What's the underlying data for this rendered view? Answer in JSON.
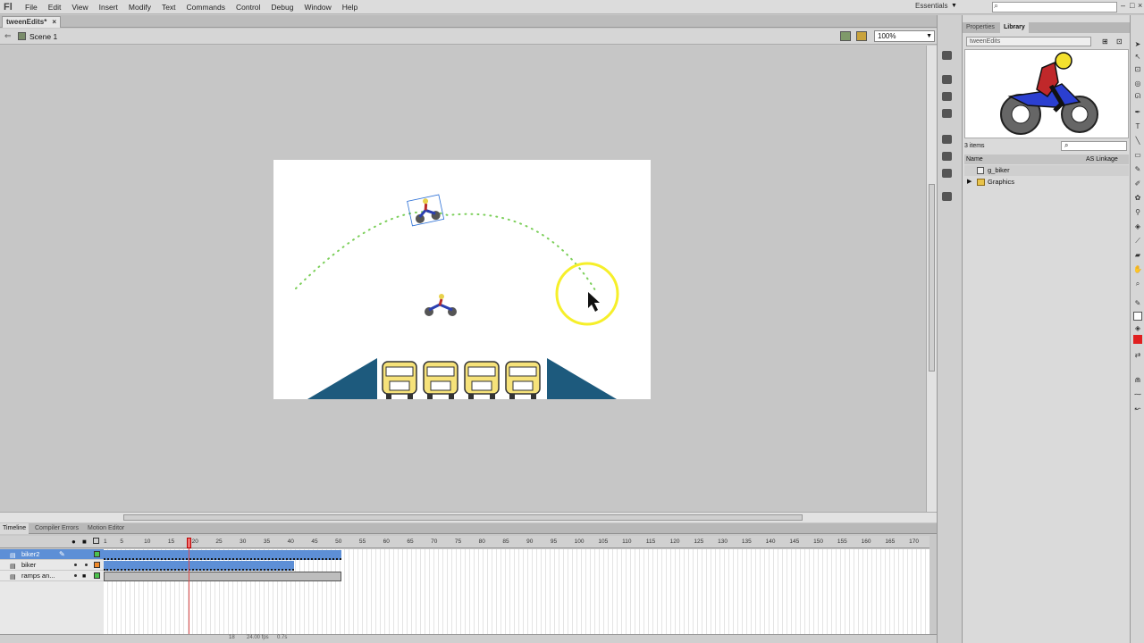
{
  "app": {
    "logo": "Fl"
  },
  "menu": [
    "File",
    "Edit",
    "View",
    "Insert",
    "Modify",
    "Text",
    "Commands",
    "Control",
    "Debug",
    "Window",
    "Help"
  ],
  "workspace": "Essentials",
  "document": {
    "tab": "tweenEdits*",
    "scene": "Scene 1",
    "zoom": "100%"
  },
  "timeline": {
    "tabs": [
      "Timeline",
      "Compiler Errors",
      "Motion Editor"
    ],
    "ticks": [
      "1",
      "5",
      "10",
      "15",
      "20",
      "25",
      "30",
      "35",
      "40",
      "45",
      "50",
      "55",
      "60",
      "65",
      "70",
      "75",
      "80",
      "85",
      "90",
      "95",
      "100",
      "105",
      "110",
      "115",
      "120",
      "125",
      "130",
      "135",
      "140",
      "145",
      "150",
      "155",
      "160",
      "165",
      "170"
    ],
    "layers": [
      "biker2",
      "biker",
      "ramps an..."
    ],
    "current_frame": 18,
    "footer_frame": "18",
    "footer_fps": "24.00 fps",
    "footer_time": "0.7s"
  },
  "library": {
    "tabs": [
      "Properties",
      "Library"
    ],
    "doc": "tweenEdits",
    "count": "3 items",
    "col_name": "Name",
    "col_linkage": "AS Linkage",
    "items": [
      "g_biker",
      "Graphics"
    ]
  },
  "colors": {
    "accent": "#5d8fd6",
    "ramp": "#1d5a7d",
    "motion_path": "#7ccf5a",
    "highlight": "#f6ef2a"
  }
}
